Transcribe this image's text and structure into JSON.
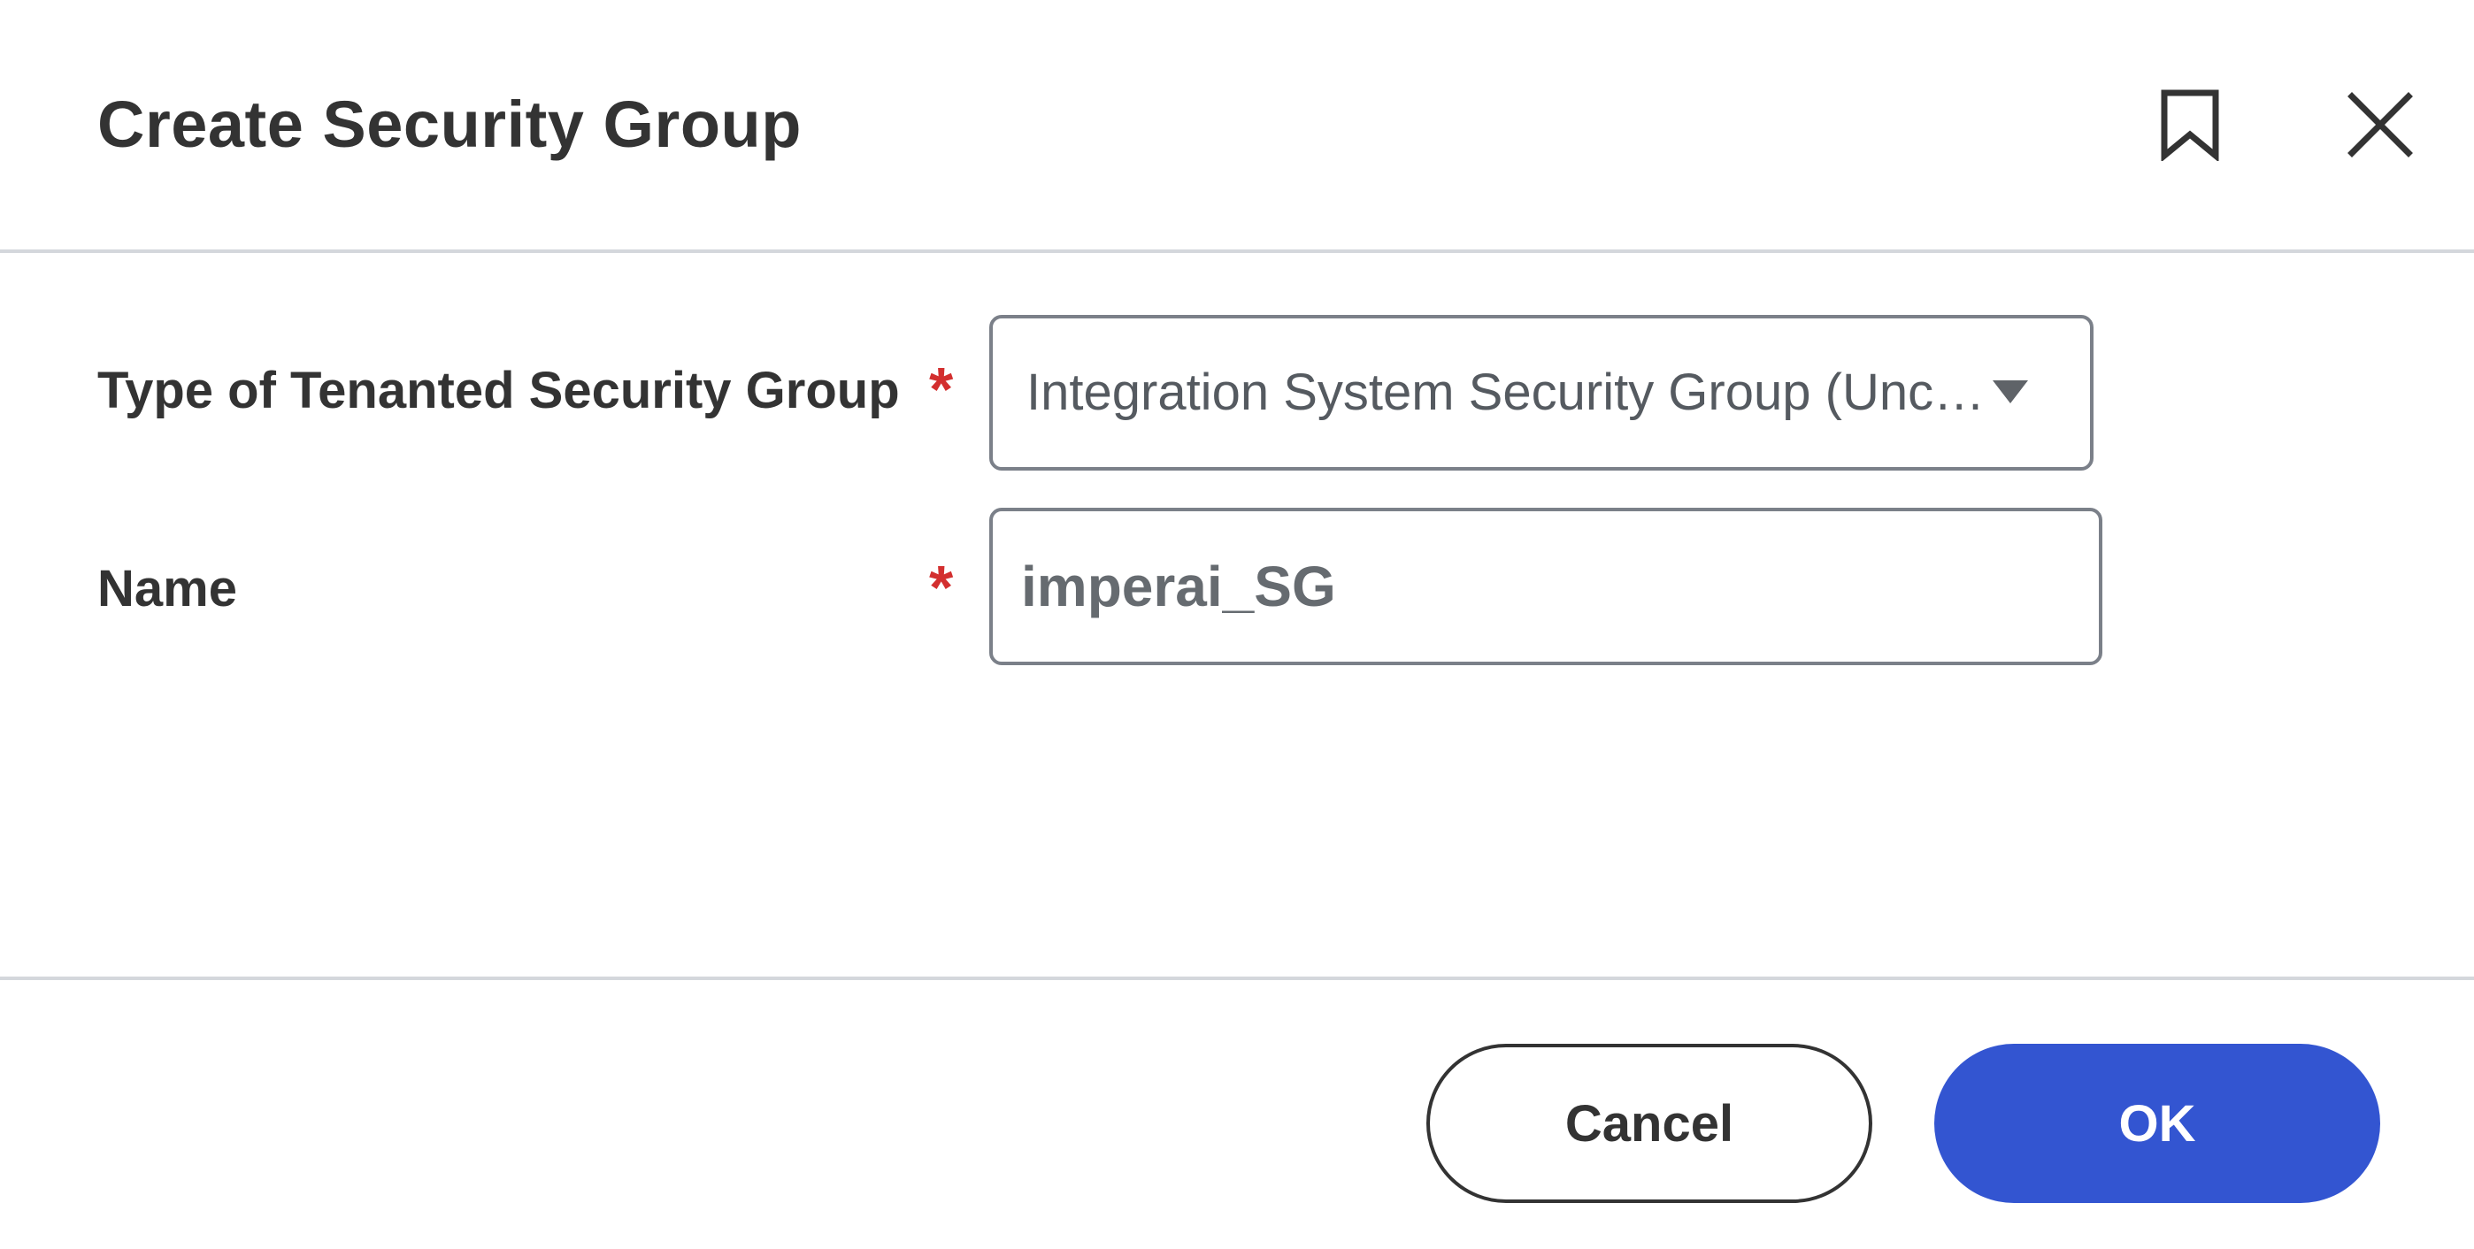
{
  "dialog": {
    "title": "Create Security Group"
  },
  "form": {
    "type_field": {
      "label": "Type of Tenanted Security Group",
      "required_mark": "*",
      "value": "Integration System Security Group (Unconstrained)"
    },
    "name_field": {
      "label": "Name",
      "required_mark": "*",
      "value": "imperai_SG"
    }
  },
  "actions": {
    "cancel_label": "Cancel",
    "ok_label": "OK"
  },
  "icons": {
    "bookmark": "bookmark-icon",
    "close": "close-icon",
    "dropdown": "chevron-down-icon"
  },
  "colors": {
    "primary": "#3355d1",
    "required": "#d32f2f",
    "text": "#333333",
    "border": "#7b8089",
    "divider": "#d4d7dc"
  }
}
